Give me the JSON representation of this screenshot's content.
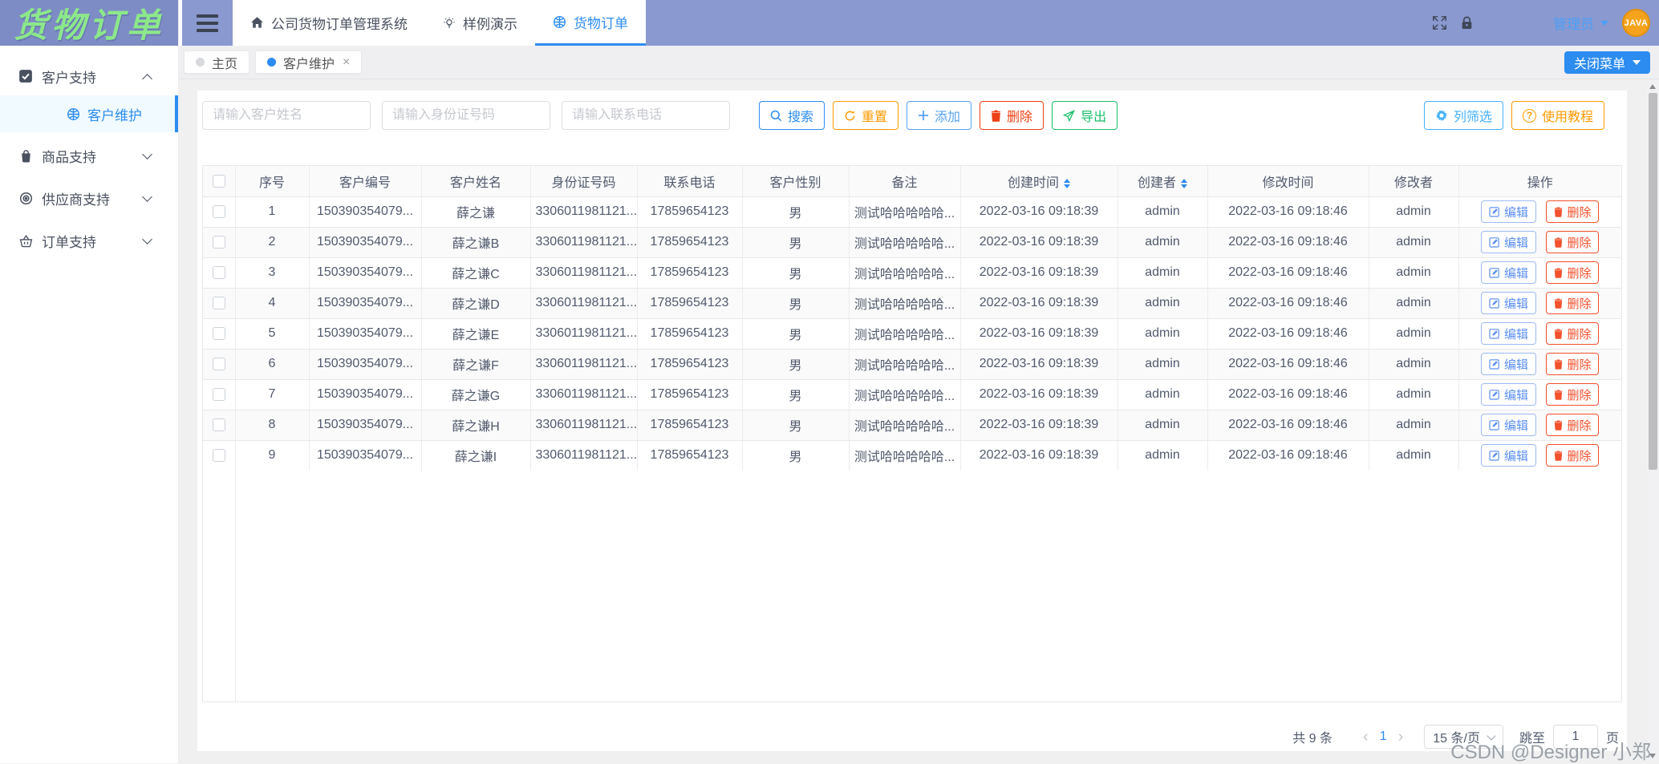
{
  "app": {
    "logo_title": "货物订单"
  },
  "navbar": {
    "items": [
      {
        "label": "公司货物订单管理系统",
        "icon": "home-icon"
      },
      {
        "label": "样例演示",
        "icon": "bulb-icon"
      },
      {
        "label": "货物订单",
        "icon": "globe-icon",
        "active": true
      }
    ],
    "user_name": "管理员",
    "avatar_text": "JAVA"
  },
  "sidebar": {
    "groups": [
      {
        "label": "客户支持",
        "expanded": true,
        "children": [
          {
            "label": "客户维护",
            "active": true
          }
        ]
      },
      {
        "label": "商品支持",
        "expanded": false
      },
      {
        "label": "供应商支持",
        "expanded": false
      },
      {
        "label": "订单支持",
        "expanded": false
      }
    ]
  },
  "tabbar": {
    "tabs": [
      {
        "label": "主页",
        "active": false
      },
      {
        "label": "客户维护",
        "active": true,
        "closable": true
      }
    ],
    "close_menu_label": "关闭菜单"
  },
  "toolbar": {
    "name_placeholder": "请输入客户姓名",
    "idcard_placeholder": "请输入身份证号码",
    "phone_placeholder": "请输入联系电话",
    "search_label": "搜索",
    "reset_label": "重置",
    "add_label": "添加",
    "delete_label": "删除",
    "export_label": "导出",
    "column_filter_label": "列筛选",
    "tutorial_label": "使用教程"
  },
  "table": {
    "columns": [
      {
        "label": "序号"
      },
      {
        "label": "客户编号"
      },
      {
        "label": "客户姓名"
      },
      {
        "label": "身份证号码"
      },
      {
        "label": "联系电话"
      },
      {
        "label": "客户性别"
      },
      {
        "label": "备注"
      },
      {
        "label": "创建时间",
        "sortable": true
      },
      {
        "label": "创建者",
        "sortable": true
      },
      {
        "label": "修改时间"
      },
      {
        "label": "修改者"
      },
      {
        "label": "操作"
      }
    ],
    "edit_label": "编辑",
    "delete_label": "删除",
    "rows": [
      {
        "index": "1",
        "customer_id": "150390354079...",
        "name": "薛之谦",
        "id_card": "3306011981121...",
        "phone": "17859654123",
        "gender": "男",
        "remark": "测试哈哈哈哈哈...",
        "created_at": "2022-03-16 09:18:39",
        "creator": "admin",
        "updated_at": "2022-03-16 09:18:46",
        "updater": "admin"
      },
      {
        "index": "2",
        "customer_id": "150390354079...",
        "name": "薛之谦B",
        "id_card": "3306011981121...",
        "phone": "17859654123",
        "gender": "男",
        "remark": "测试哈哈哈哈哈...",
        "created_at": "2022-03-16 09:18:39",
        "creator": "admin",
        "updated_at": "2022-03-16 09:18:46",
        "updater": "admin"
      },
      {
        "index": "3",
        "customer_id": "150390354079...",
        "name": "薛之谦C",
        "id_card": "3306011981121...",
        "phone": "17859654123",
        "gender": "男",
        "remark": "测试哈哈哈哈哈...",
        "created_at": "2022-03-16 09:18:39",
        "creator": "admin",
        "updated_at": "2022-03-16 09:18:46",
        "updater": "admin"
      },
      {
        "index": "4",
        "customer_id": "150390354079...",
        "name": "薛之谦D",
        "id_card": "3306011981121...",
        "phone": "17859654123",
        "gender": "男",
        "remark": "测试哈哈哈哈哈...",
        "created_at": "2022-03-16 09:18:39",
        "creator": "admin",
        "updated_at": "2022-03-16 09:18:46",
        "updater": "admin"
      },
      {
        "index": "5",
        "customer_id": "150390354079...",
        "name": "薛之谦E",
        "id_card": "3306011981121...",
        "phone": "17859654123",
        "gender": "男",
        "remark": "测试哈哈哈哈哈...",
        "created_at": "2022-03-16 09:18:39",
        "creator": "admin",
        "updated_at": "2022-03-16 09:18:46",
        "updater": "admin"
      },
      {
        "index": "6",
        "customer_id": "150390354079...",
        "name": "薛之谦F",
        "id_card": "3306011981121...",
        "phone": "17859654123",
        "gender": "男",
        "remark": "测试哈哈哈哈哈...",
        "created_at": "2022-03-16 09:18:39",
        "creator": "admin",
        "updated_at": "2022-03-16 09:18:46",
        "updater": "admin"
      },
      {
        "index": "7",
        "customer_id": "150390354079...",
        "name": "薛之谦G",
        "id_card": "3306011981121...",
        "phone": "17859654123",
        "gender": "男",
        "remark": "测试哈哈哈哈哈...",
        "created_at": "2022-03-16 09:18:39",
        "creator": "admin",
        "updated_at": "2022-03-16 09:18:46",
        "updater": "admin"
      },
      {
        "index": "8",
        "customer_id": "150390354079...",
        "name": "薛之谦H",
        "id_card": "3306011981121...",
        "phone": "17859654123",
        "gender": "男",
        "remark": "测试哈哈哈哈哈...",
        "created_at": "2022-03-16 09:18:39",
        "creator": "admin",
        "updated_at": "2022-03-16 09:18:46",
        "updater": "admin"
      },
      {
        "index": "9",
        "customer_id": "150390354079...",
        "name": "薛之谦I",
        "id_card": "3306011981121...",
        "phone": "17859654123",
        "gender": "男",
        "remark": "测试哈哈哈哈哈...",
        "created_at": "2022-03-16 09:18:39",
        "creator": "admin",
        "updated_at": "2022-03-16 09:18:46",
        "updater": "admin"
      }
    ]
  },
  "pagination": {
    "total_text": "共 9 条",
    "prev_icon": "‹",
    "current_page": "1",
    "next_icon": "›",
    "page_size_label": "15 条/页",
    "jump_prefix": "跳至",
    "jump_value": "1",
    "jump_suffix": "页"
  },
  "watermark_text": "CSDN @Designer 小郑",
  "colors": {
    "navbar_bg": "#8a99cf",
    "logo_bg": "#7e8cc6",
    "logo_text": "#8ce88a",
    "primary": "#2d8cf0",
    "warning": "#ff9900",
    "info_blue": "#57a3f3",
    "danger": "#ed4014",
    "success": "#19be6b",
    "avatar_bg": "#f5a31d"
  }
}
